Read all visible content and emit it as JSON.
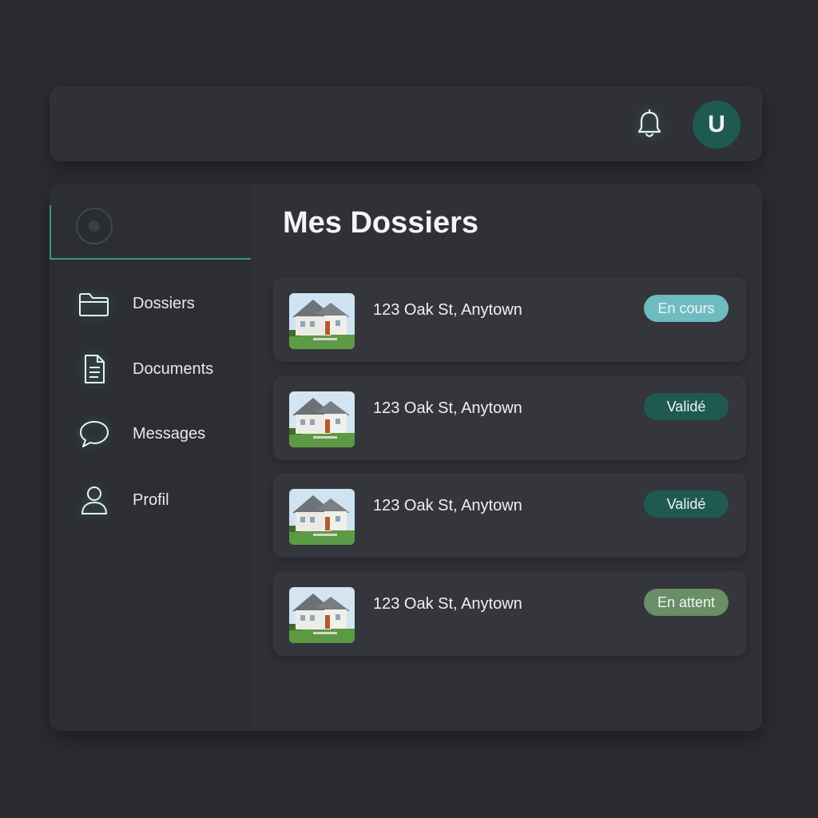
{
  "header": {
    "avatar_initial": "U",
    "bell_icon": "bell-icon"
  },
  "sidebar": {
    "logo_icon": "logo-circle-icon",
    "items": [
      {
        "label": "Dossiers",
        "icon": "folder-icon"
      },
      {
        "label": "Documents",
        "icon": "document-icon"
      },
      {
        "label": "Messages",
        "icon": "chat-bubble-icon"
      },
      {
        "label": "Profil",
        "icon": "user-icon"
      }
    ]
  },
  "main": {
    "title": "Mes Dossiers",
    "rows": [
      {
        "address": "123 Oak St, Anytown",
        "status": "En cours"
      },
      {
        "address": "123 Oak St, Anytown",
        "status": "Validé"
      },
      {
        "address": "123 Oak St, Anytown",
        "status": "Validé"
      },
      {
        "address": "123 Oak St, Anytown",
        "status": "En attent"
      }
    ]
  },
  "colors": {
    "accent": "#2f9a8c",
    "status_en_cours": "#6fbcc0",
    "status_valide": "#1f5a52",
    "status_en_attente": "#6a8e66"
  }
}
